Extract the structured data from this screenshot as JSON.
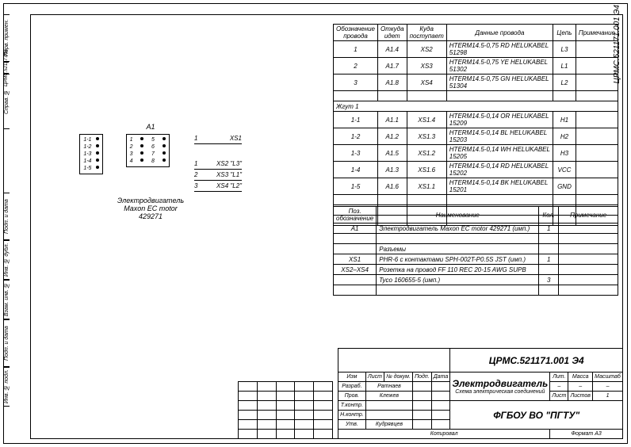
{
  "drawing_number": "ЦРМС.521171.001 Э4",
  "drawing_number_side": "ЦРМС.52117.001",
  "sidebar": {
    "blocks": [
      "Перв. примен.",
      "Справ. №",
      "Подп. и дата",
      "Инв. № дубл.",
      "Взам. инв. №",
      "Подп. и дата",
      "Инв. № подл."
    ]
  },
  "component": {
    "ref": "A1",
    "name1": "Электродвигатель",
    "name2": "Maxon EC motor",
    "name3": "429271",
    "connector_left": [
      "1-1",
      "1-2",
      "1-3",
      "1-4",
      "1-5"
    ],
    "pins_right": [
      "1",
      "2",
      "3",
      "4",
      "5",
      "6",
      "7",
      "8"
    ]
  },
  "wire_outputs": [
    {
      "num": "1",
      "to": "XS1",
      "sig": ""
    },
    {
      "num": "1",
      "to": "XS2",
      "sig": "\"L3\""
    },
    {
      "num": "2",
      "to": "XS3",
      "sig": "\"L1\""
    },
    {
      "num": "3",
      "to": "XS4",
      "sig": "\"L2\""
    }
  ],
  "wires_table": {
    "headers": [
      "Обозначение провода",
      "Откуда идет",
      "Куда поступает",
      "Данные провода",
      "Цепь",
      "Примечание"
    ],
    "rows": [
      [
        "1",
        "A1.4",
        "XS2",
        "HTERM14.5-0,75 RD HELUKABEL  51298",
        "L3",
        ""
      ],
      [
        "2",
        "A1.7",
        "XS3",
        "HTERM14.5-0,75 YE HELUKABEL  51302",
        "L1",
        ""
      ],
      [
        "3",
        "A1.8",
        "XS4",
        "HTERM14.5-0,75 GN HELUKABEL  51304",
        "L2",
        ""
      ],
      [
        "",
        "",
        "",
        "",
        "",
        ""
      ]
    ],
    "group": "Жгут 1",
    "group_rows": [
      [
        "1-1",
        "A1.1",
        "XS1.4",
        "HTERM14.5-0,14 OR HELUKABEL  15209",
        "H1",
        ""
      ],
      [
        "1-2",
        "A1.2",
        "XS1.3",
        "HTERM14.5-0,14 BL HELUKABEL  15203",
        "H2",
        ""
      ],
      [
        "1-3",
        "A1.5",
        "XS1.2",
        "HTERM14.5-0,14 WH HELUKABEL  15205",
        "H3",
        ""
      ],
      [
        "1-4",
        "A1.3",
        "XS1.6",
        "HTERM14.5-0,14 RD HELUKABEL  15202",
        "VCC",
        ""
      ],
      [
        "1-5",
        "A1.6",
        "XS1.1",
        "HTERM14.5-0,14 BK HELUKABEL  15201",
        "GND",
        ""
      ],
      [
        "",
        "",
        "",
        "",
        "",
        ""
      ],
      [
        "",
        "",
        "",
        "",
        "",
        ""
      ],
      [
        "",
        "",
        "",
        "",
        "",
        ""
      ]
    ]
  },
  "parts_table": {
    "headers": [
      "Поз. обозначение",
      "Наименование",
      "Кол.",
      "Примечание"
    ],
    "rows": [
      [
        "A1",
        "Электродвигатель Maxon EC motor 429271 (имп.)",
        "1",
        ""
      ],
      [
        "",
        "",
        "",
        ""
      ],
      [
        "",
        "Разъемы",
        "",
        ""
      ],
      [
        "XS1",
        "PHR-6 с контактами SPH-002T-P0.5S JST (имп.)",
        "1",
        ""
      ],
      [
        "XS2–XS4",
        "Розетка на провод FF 110 REC 20-15 AWG SUPB",
        "",
        ""
      ],
      [
        "",
        "Tyco 160655-5 (имп.)",
        "3",
        ""
      ],
      [
        "",
        "",
        "",
        ""
      ]
    ]
  },
  "title_block": {
    "number": "ЦРМС.521171.001 Э4",
    "name": "Электродвигатель",
    "subtitle": "Схема электрическая соединений",
    "org": "ФГБОУ ВО \"ПГТУ\"",
    "lit": "Лит.",
    "mass": "Масса",
    "scale": "Масштаб",
    "sheet_lbl": "Лист",
    "sheets_lbl": "Листов",
    "sheets": "1",
    "format_lbl": "Копировал",
    "format": "Формат    A3",
    "roles": [
      [
        "Изм",
        "Лист",
        "№ докум.",
        "Подп.",
        "Дата"
      ],
      [
        "Разраб.",
        "Ратнаев",
        "",
        ""
      ],
      [
        "Пров.",
        "Клежев",
        "",
        ""
      ],
      [
        "Т.контр.",
        "",
        "",
        ""
      ],
      [
        "Н.контр.",
        "",
        "",
        ""
      ],
      [
        "Утв.",
        "Кудрявцев",
        "",
        ""
      ]
    ]
  }
}
